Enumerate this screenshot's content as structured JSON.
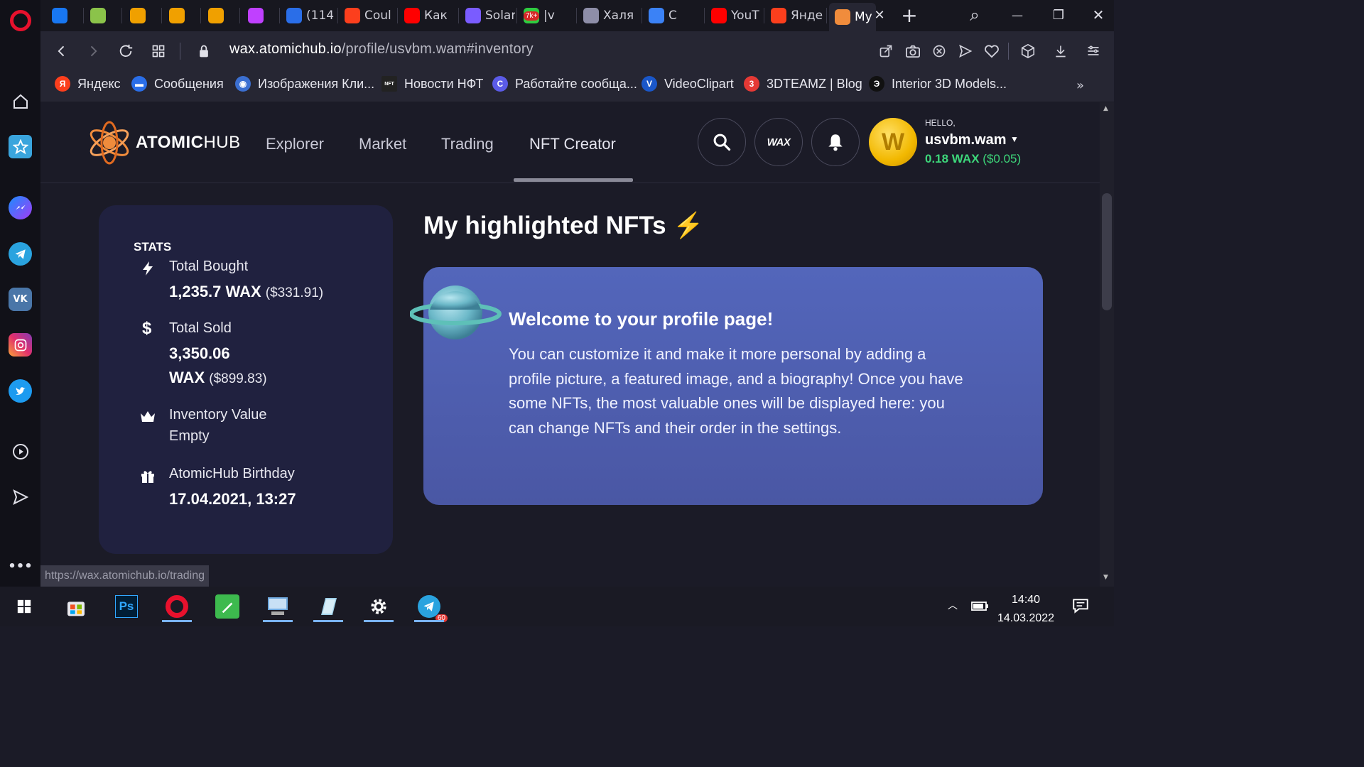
{
  "browser": {
    "tabs": [
      {
        "label": "",
        "icon": "messenger-icon",
        "color": "#1877f2"
      },
      {
        "label": "",
        "icon": "frog-icon",
        "color": "#8bc34a"
      },
      {
        "label": "",
        "icon": "wax-w-icon",
        "color": "#f0a000"
      },
      {
        "label": "",
        "icon": "wax-w-icon",
        "color": "#f0a000"
      },
      {
        "label": "",
        "icon": "wax-w-icon",
        "color": "#f0a000"
      },
      {
        "label": "",
        "icon": "c-icon",
        "color": "#c040ff"
      },
      {
        "label": "(114",
        "icon": "mail-icon",
        "color": "#2a6ee8"
      },
      {
        "label": "Coul",
        "icon": "yandex-icon",
        "color": "#fc3f1d"
      },
      {
        "label": "Как",
        "icon": "youtube-icon",
        "color": "#ff0000"
      },
      {
        "label": "Solar",
        "icon": "solar-icon",
        "color": "#7a5cff"
      },
      {
        "label": "|v",
        "icon": "check-icon",
        "color": "#2ecc40"
      },
      {
        "label": "Халя",
        "icon": "game-icon",
        "color": "#8e8ea8"
      },
      {
        "label": "C",
        "icon": "speaker-icon",
        "color": "#3b82f6"
      },
      {
        "label": "YouT",
        "icon": "youtube-icon",
        "color": "#ff0000"
      },
      {
        "label": "Янде",
        "icon": "yandex-icon",
        "color": "#fc3f1d"
      },
      {
        "label": "My",
        "icon": "atomichub-icon",
        "color": "#f08c3c"
      }
    ],
    "badge_7k": "7k+",
    "url_domain": "wax.atomichub.io",
    "url_path": "/profile/usvbm.wam#inventory",
    "bookmarks": [
      {
        "label": "Яндекс",
        "icon": "yandex-icon",
        "color": "#fc3f1d",
        "glyph": "Я"
      },
      {
        "label": "Сообщения",
        "icon": "chat-icon",
        "color": "#2a6ee8",
        "glyph": "▬"
      },
      {
        "label": "Изображения Кли...",
        "icon": "clipart-icon",
        "color": "#3b6fd1",
        "glyph": "◉"
      },
      {
        "label": "Новости НФТ",
        "icon": "nft-icon",
        "color": "#222222",
        "glyph": "NFT"
      },
      {
        "label": "Работайте сообща...",
        "icon": "c-logo-icon",
        "color": "#5b5be8",
        "glyph": "C"
      },
      {
        "label": "VideoClipart",
        "icon": "v-icon",
        "color": "#1a57c9",
        "glyph": "V"
      },
      {
        "label": "3DTEAMZ | Blog",
        "icon": "3dteamz-icon",
        "color": "#e53935",
        "glyph": "3"
      },
      {
        "label": "Interior 3D Models...",
        "icon": "e-icon",
        "color": "#111111",
        "glyph": "Э"
      }
    ],
    "status_url": "https://wax.atomichub.io/trading"
  },
  "site": {
    "logo_bold": "ATOMIC",
    "logo_light": "HUB",
    "nav": [
      "Explorer",
      "Market",
      "Trading",
      "NFT Creator"
    ],
    "wax_label": "WAX",
    "coin_letter": "W",
    "hello": "HELLO,",
    "username": "usvbm.wam",
    "balance_wax": "0.18 WAX",
    "balance_usd": "($0.05)"
  },
  "stats": {
    "title": "STATS",
    "total_bought_label": "Total Bought",
    "total_bought_value": "1,235.7 WAX",
    "total_bought_usd": "($331.91)",
    "total_sold_label": "Total Sold",
    "total_sold_value_1": "3,350.06",
    "total_sold_value_2": "WAX",
    "total_sold_usd": "($899.83)",
    "inventory_label": "Inventory Value",
    "inventory_value": "Empty",
    "birthday_label": "AtomicHub Birthday",
    "birthday_value": "17.04.2021, 13:27"
  },
  "highlight": {
    "title": "My highlighted NFTs",
    "emoji": "⚡",
    "welcome_title": "Welcome to your profile page!",
    "welcome_body": "You can customize it and make it more personal by adding a profile picture, a featured image, and a biography! Once you have some NFTs, the most valuable ones will be displayed here: you can change NFTs and their order in the settings."
  },
  "taskbar": {
    "time": "14:40",
    "date": "14.03.2022",
    "telegram_badge": "60",
    "ps_label": "Ps"
  }
}
